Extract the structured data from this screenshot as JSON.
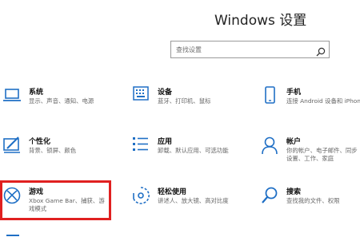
{
  "header": {
    "title": "Windows 设置"
  },
  "search": {
    "placeholder": "查找设置",
    "icon": "search-icon"
  },
  "accent": "#1f6fc5",
  "highlight_color": "#e02020",
  "tiles": [
    {
      "id": "system",
      "name": "系统",
      "desc": "显示、声音、通知、电源",
      "icon": "laptop-icon"
    },
    {
      "id": "devices",
      "name": "设备",
      "desc": "蓝牙、打印机、鼠标",
      "icon": "keyboard-icon"
    },
    {
      "id": "phone",
      "name": "手机",
      "desc": "连接 Android 设备和 iPhone",
      "icon": "phone-icon"
    },
    {
      "id": "personalize",
      "name": "个性化",
      "desc": "背景、锁屏、颜色",
      "icon": "paint-icon"
    },
    {
      "id": "apps",
      "name": "应用",
      "desc": "卸载、默认应用、可选功能",
      "icon": "apps-list-icon"
    },
    {
      "id": "accounts",
      "name": "帐户",
      "desc": "你的帐户、电子邮件、同步设置、工作、家庭",
      "icon": "person-icon"
    },
    {
      "id": "gaming",
      "name": "游戏",
      "desc": "Xbox Game Bar、捕获、游戏模式",
      "icon": "xbox-icon"
    },
    {
      "id": "ease",
      "name": "轻松使用",
      "desc": "讲述人、放大镜、高对比度",
      "icon": "ease-of-access-icon"
    },
    {
      "id": "search",
      "name": "搜索",
      "desc": "查找我的文件、权限",
      "icon": "magnifier-icon"
    }
  ]
}
